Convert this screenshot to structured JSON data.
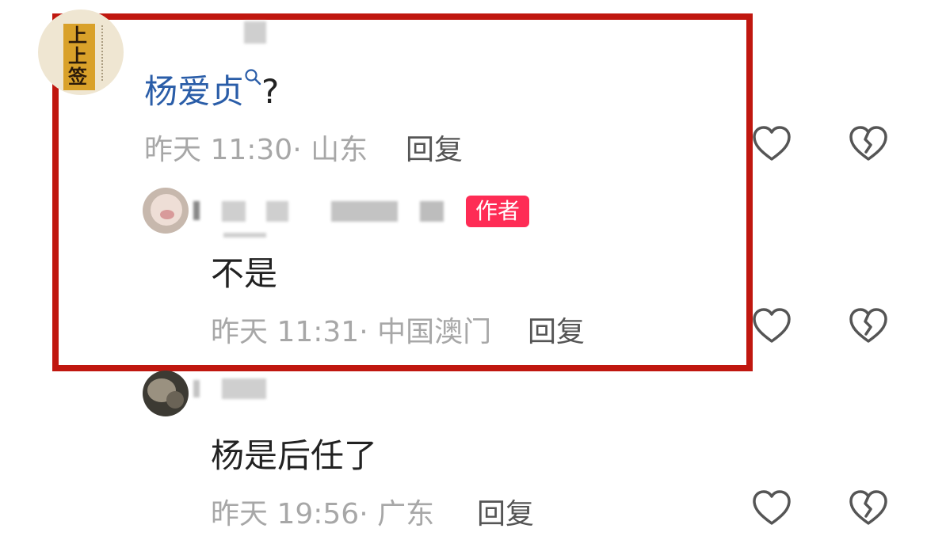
{
  "comment": {
    "avatar_text": "上上签",
    "mention": "杨爱贞",
    "suffix": "?",
    "time": "昨天 11:30",
    "dot": "·",
    "location": "山东",
    "reply_label": "回复"
  },
  "replies": [
    {
      "badge": "作者",
      "text": "不是",
      "time": "昨天 11:31",
      "dot": "·",
      "location": "中国澳门",
      "reply_label": "回复"
    },
    {
      "text": "杨是后任了",
      "time": "昨天 19:56",
      "dot": "·",
      "location": "广东",
      "reply_label": "回复"
    }
  ],
  "icons": {
    "like": "heart-icon",
    "dislike": "broken-heart-icon"
  },
  "colors": {
    "highlight_border": "#c0170f",
    "mention_blue": "#2a5da8",
    "badge_bg": "#fe2c55"
  }
}
